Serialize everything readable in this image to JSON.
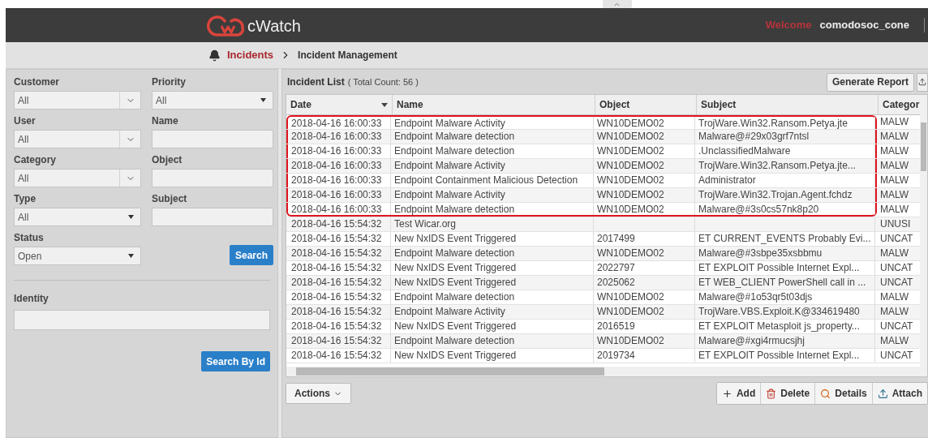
{
  "header": {
    "brand": "cWatch",
    "welcome": "Welcome",
    "user": "comodosoc_cone"
  },
  "breadcrumb": [
    {
      "label": "Incidents",
      "current": false
    },
    {
      "label": "Incident Management",
      "current": true
    }
  ],
  "filters": [
    {
      "label": "Customer",
      "kind": "combo",
      "value": "All"
    },
    {
      "label": "Priority",
      "kind": "select",
      "value": "All"
    },
    {
      "label": "User",
      "kind": "combo",
      "value": "All"
    },
    {
      "label": "Name",
      "kind": "input"
    },
    {
      "label": "Category",
      "kind": "combo",
      "value": "All"
    },
    {
      "label": "Object",
      "kind": "input"
    },
    {
      "label": "Type",
      "kind": "select",
      "value": "All"
    },
    {
      "label": "Subject",
      "kind": "input"
    },
    {
      "label": "Status",
      "kind": "select",
      "value": "Open"
    }
  ],
  "search_button": "Search",
  "identity": {
    "label": "Identity",
    "button": "Search By Id"
  },
  "incident_list": {
    "title": "Incident List",
    "count": "( Total Count: 56 )",
    "generate_report": "Generate Report",
    "columns": [
      "Date",
      "Name",
      "Object",
      "Subject",
      "Categor"
    ],
    "rows": [
      {
        "cells": [
          "2018-04-16 16:00:33",
          "Endpoint Malware Activity",
          "WN10DEMO02",
          "TrojWare.Win32.Ransom.Petya.jte",
          "MALW"
        ],
        "highlighted": true
      },
      {
        "cells": [
          "2018-04-16 16:00:33",
          "Endpoint Malware detection",
          "WN10DEMO02",
          "Malware@#29x03grf7ntsl",
          "MALW"
        ],
        "highlighted": true
      },
      {
        "cells": [
          "2018-04-16 16:00:33",
          "Endpoint Malware detection",
          "WN10DEMO02",
          ".UnclassifiedMalware",
          "MALW"
        ],
        "highlighted": true
      },
      {
        "cells": [
          "2018-04-16 16:00:33",
          "Endpoint Malware Activity",
          "WN10DEMO02",
          "TrojWare.Win32.Ransom.Petya.jte...",
          "MALW"
        ],
        "highlighted": true
      },
      {
        "cells": [
          "2018-04-16 16:00:33",
          "Endpoint Containment Malicious Detection",
          "WN10DEMO02",
          "Administrator",
          "MALW"
        ],
        "highlighted": true
      },
      {
        "cells": [
          "2018-04-16 16:00:33",
          "Endpoint Malware Activity",
          "WN10DEMO02",
          "TrojWare.Win32.Trojan.Agent.fchdz",
          "MALW"
        ],
        "highlighted": true
      },
      {
        "cells": [
          "2018-04-16 16:00:33",
          "Endpoint Malware detection",
          "WN10DEMO02",
          "Malware@#3s0cs57nk8p20",
          "MALW"
        ],
        "highlighted": true
      },
      {
        "cells": [
          "2018-04-16 15:54:32",
          "Test Wicar.org",
          "",
          "",
          "UNUSI"
        ],
        "highlighted": false
      },
      {
        "cells": [
          "2018-04-16 15:54:32",
          "New NxIDS Event Triggered",
          "2017499",
          "ET CURRENT_EVENTS Probably Evi...",
          "UNCAT"
        ],
        "highlighted": false
      },
      {
        "cells": [
          "2018-04-16 15:54:32",
          "Endpoint Malware detection",
          "WN10DEMO02",
          "Malware@#3sbpe35xsbbmu",
          "MALW"
        ],
        "highlighted": false
      },
      {
        "cells": [
          "2018-04-16 15:54:32",
          "New NxIDS Event Triggered",
          "2022797",
          "ET EXPLOIT Possible Internet Expl...",
          "UNCAT"
        ],
        "highlighted": false
      },
      {
        "cells": [
          "2018-04-16 15:54:32",
          "New NxIDS Event Triggered",
          "2025062",
          "ET WEB_CLIENT PowerShell call in ...",
          "UNCAT"
        ],
        "highlighted": false
      },
      {
        "cells": [
          "2018-04-16 15:54:32",
          "Endpoint Malware detection",
          "WN10DEMO02",
          "Malware@#1o53qr5t03djs",
          "MALW"
        ],
        "highlighted": false
      },
      {
        "cells": [
          "2018-04-16 15:54:32",
          "Endpoint Malware Activity",
          "WN10DEMO02",
          "TrojWare.VBS.Exploit.K@334619480",
          "MALW"
        ],
        "highlighted": false
      },
      {
        "cells": [
          "2018-04-16 15:54:32",
          "New NxIDS Event Triggered",
          "2016519",
          "ET EXPLOIT Metasploit js_property...",
          "UNCAT"
        ],
        "highlighted": false
      },
      {
        "cells": [
          "2018-04-16 15:54:32",
          "Endpoint Malware detection",
          "WN10DEMO02",
          "Malware@#xgi4rmucsjhj",
          "MALW"
        ],
        "highlighted": false
      },
      {
        "cells": [
          "2018-04-16 15:54:32",
          "New NxIDS Event Triggered",
          "2019734",
          "ET EXPLOIT Possible Internet Expl...",
          "UNCAT"
        ],
        "highlighted": false
      }
    ]
  },
  "actions": "Actions",
  "toolbar": [
    "Add",
    "Delete",
    "Details",
    "Attach"
  ]
}
